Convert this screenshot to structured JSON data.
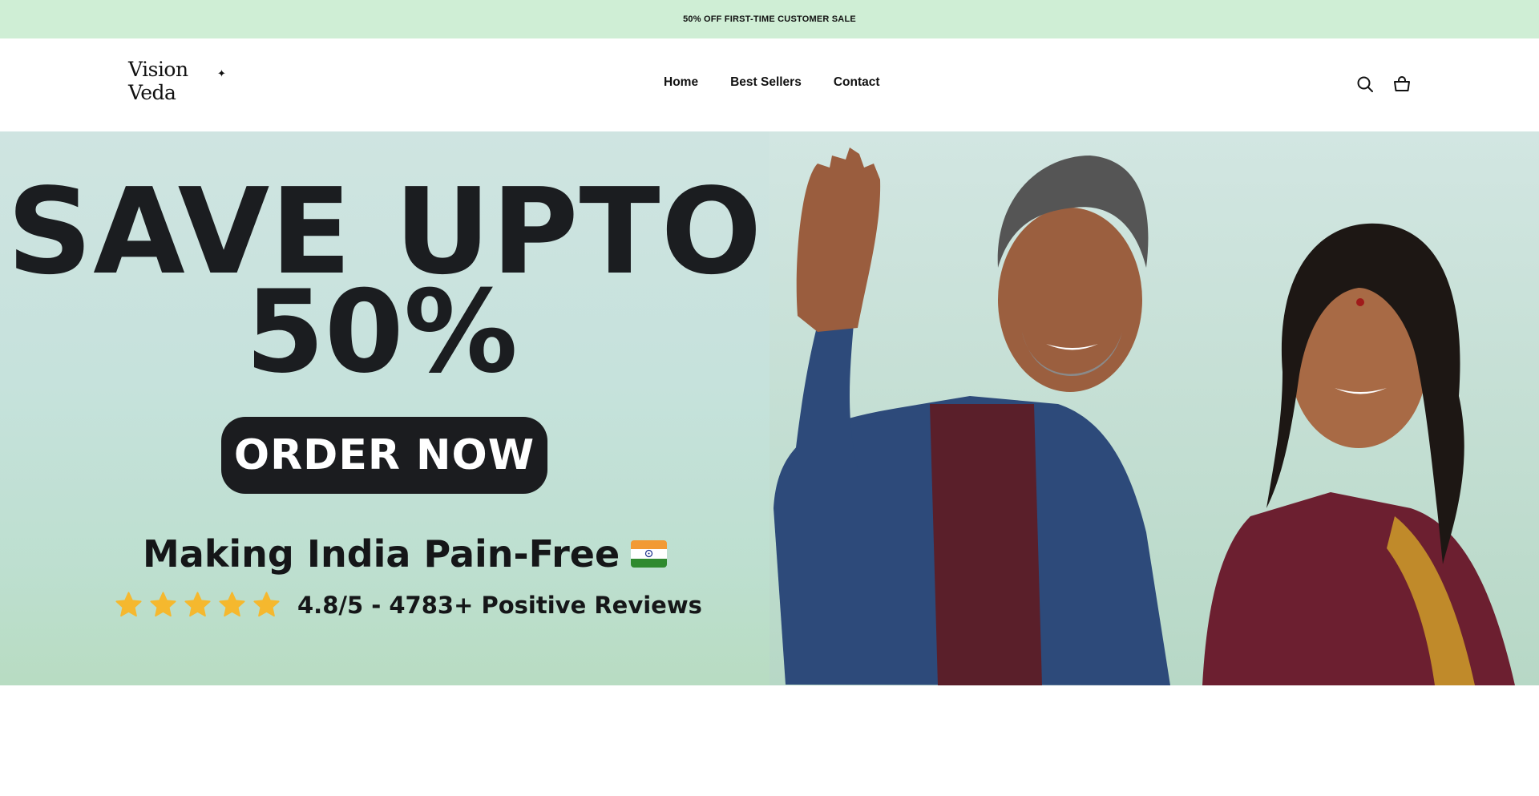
{
  "announcement": {
    "text": "50% OFF FIRST-TIME CUSTOMER SALE"
  },
  "header": {
    "logo_text": "Vision Veda",
    "nav": [
      {
        "label": "Home"
      },
      {
        "label": "Best Sellers"
      },
      {
        "label": "Contact"
      }
    ],
    "icons": {
      "search": "search-icon",
      "cart": "cart-icon"
    }
  },
  "hero": {
    "headline_line1": "SAVE UPTO",
    "headline_line2": "50%",
    "cta_label": "ORDER NOW",
    "tagline": "Making India Pain-Free",
    "rating_text": "4.8/5 - 4783+ Positive Reviews",
    "star_count": 5,
    "colors": {
      "star": "#f5b82e",
      "button": "#1b1c1f",
      "announcement_bg": "#cfeed5"
    }
  }
}
